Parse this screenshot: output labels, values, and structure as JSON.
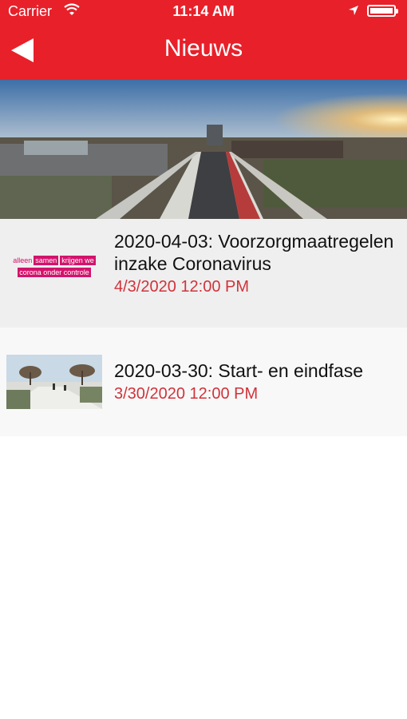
{
  "status_bar": {
    "carrier": "Carrier",
    "time": "11:14 AM",
    "battery_level": 1.0
  },
  "nav": {
    "title": "Nieuws",
    "back_icon": "back-arrow-icon"
  },
  "news": [
    {
      "title": "2020-04-03: Voorzorgmaatregelen inzake Coronavirus",
      "date": "4/3/2020 12:00 PM",
      "logo_line1": [
        "alleen",
        "samen",
        "krijgen we"
      ],
      "logo_line2": "corona onder controle"
    },
    {
      "title": "2020-03-30: Start- en eindfase",
      "date": "3/30/2020 12:00 PM"
    }
  ],
  "colors": {
    "accent": "#e8202a",
    "date": "#d0333b",
    "logo": "#d3136c"
  }
}
